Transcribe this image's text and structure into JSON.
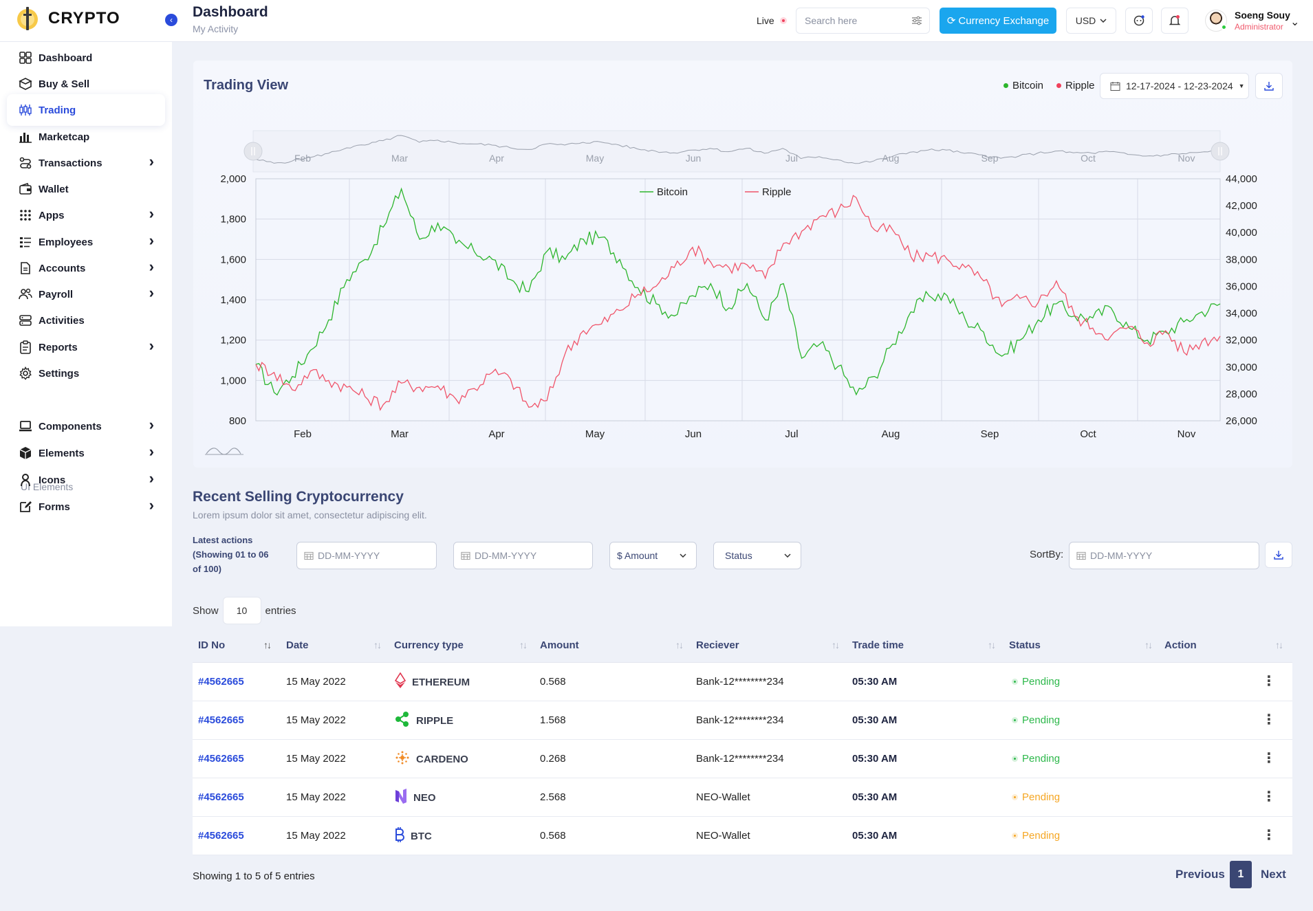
{
  "brand": {
    "name": "CRYPTO"
  },
  "header": {
    "title": "Dashboard",
    "subtitle": "My Activity",
    "live_label": "Live",
    "search_placeholder": "Search here",
    "exchange_label": "Currency Exchange",
    "currency": "USD",
    "user_name": "Soeng Souy",
    "user_role": "Administrator"
  },
  "sidebar": {
    "items": [
      {
        "label": "Dashboard",
        "icon": "grid-icon",
        "chevron": false
      },
      {
        "label": "Buy & Sell",
        "icon": "box-icon",
        "chevron": false
      },
      {
        "label": "Trading",
        "icon": "candlestick-icon",
        "chevron": false,
        "active": true
      },
      {
        "label": "Marketcap",
        "icon": "bar-chart-icon",
        "chevron": false
      },
      {
        "label": "Transactions",
        "icon": "transfer-icon",
        "chevron": true
      },
      {
        "label": "Wallet",
        "icon": "wallet-icon",
        "chevron": false
      },
      {
        "label": "Apps",
        "icon": "apps-icon",
        "chevron": true
      },
      {
        "label": "Employees",
        "icon": "list-icon",
        "chevron": true
      },
      {
        "label": "Accounts",
        "icon": "document-icon",
        "chevron": true
      },
      {
        "label": "Payroll",
        "icon": "users-icon",
        "chevron": true
      },
      {
        "label": "Activities",
        "icon": "server-icon",
        "chevron": false
      },
      {
        "label": "Reports",
        "icon": "clipboard-icon",
        "chevron": true
      },
      {
        "label": "Settings",
        "icon": "gear-icon",
        "chevron": false
      }
    ],
    "section_label": "UI Elements",
    "ui_items": [
      {
        "label": "Components",
        "icon": "laptop-icon",
        "chevron": true
      },
      {
        "label": "Elements",
        "icon": "cube-icon",
        "chevron": true
      },
      {
        "label": "Icons",
        "icon": "person-icon",
        "chevron": true
      },
      {
        "label": "Forms",
        "icon": "edit-icon",
        "chevron": true
      }
    ]
  },
  "trading": {
    "title": "Trading View",
    "legend": [
      "Bitcoin",
      "Ripple"
    ],
    "date_range": "12-17-2024 - 12-23-2024"
  },
  "chart_data": {
    "type": "line",
    "x_labels": [
      "Feb",
      "Mar",
      "Apr",
      "May",
      "Jun",
      "Jul",
      "Aug",
      "Sep",
      "Oct",
      "Nov"
    ],
    "y_left_ticks": [
      "2,000",
      "1,800",
      "1,600",
      "1,400",
      "1,200",
      "1,000",
      "800"
    ],
    "y_right_ticks": [
      "44,000",
      "42,000",
      "40,000",
      "38,000",
      "36,000",
      "34,000",
      "32,000",
      "30,000",
      "28,000",
      "26,000"
    ],
    "ylim_left": [
      800,
      2000
    ],
    "ylim_right": [
      26000,
      44000
    ],
    "grid": true,
    "legend_position": "top-center",
    "colors": {
      "Bitcoin": "#2cb52c",
      "Ripple": "#f0546a"
    },
    "series": [
      {
        "name": "Bitcoin",
        "axis": "left",
        "values": [
          1080,
          940,
          1020,
          1150,
          1300,
          1500,
          1600,
          1760,
          1950,
          1700,
          1780,
          1680,
          1640,
          1600,
          1500,
          1440,
          1640,
          1600,
          1700,
          1710,
          1600,
          1460,
          1380,
          1320,
          1420,
          1480,
          1360,
          1480,
          1300,
          1480,
          1110,
          1180,
          1070,
          930,
          1020,
          1180,
          1340,
          1420,
          1420,
          1300,
          1240,
          1120,
          1200,
          1300,
          1380,
          1320,
          1310,
          1360,
          1260,
          1200,
          1240,
          1290,
          1340,
          1380
        ]
      },
      {
        "name": "Ripple",
        "axis": "right",
        "values": [
          30200,
          29600,
          28300,
          29700,
          29000,
          28500,
          27800,
          27200,
          28800,
          28500,
          28600,
          27600,
          28400,
          29600,
          29100,
          27000,
          27500,
          31000,
          32700,
          33200,
          34200,
          35400,
          36000,
          37400,
          38900,
          37800,
          37400,
          37600,
          36600,
          39200,
          40100,
          41200,
          41600,
          42600,
          40200,
          40200,
          38200,
          38300,
          38000,
          37400,
          36400,
          34500,
          35100,
          34800,
          36400,
          33800,
          32900,
          32300,
          33000,
          31800,
          32700,
          31100,
          31900,
          32300
        ]
      }
    ],
    "navigator_labels": [
      "Feb",
      "Mar",
      "Apr",
      "May",
      "Jun",
      "Jul",
      "Aug",
      "Sep",
      "Oct",
      "Nov"
    ]
  },
  "recent": {
    "title": "Recent Selling Cryptocurrency",
    "subtitle": "Lorem ipsum dolor sit amet, consectetur adipiscing elit.",
    "latest_line1": "Latest actions",
    "latest_line2": "(Showing 01 to 06",
    "latest_line3": "of 100)",
    "date_placeholder": "DD-MM-YYYY",
    "amount_label": "$ Amount",
    "status_label": "Status",
    "sortby_label": "SortBy:",
    "show_label": "Show",
    "show_value": "10",
    "entries_label": "entries",
    "columns": [
      "ID No",
      "Date",
      "Currency type",
      "Amount",
      "Reciever",
      "Trade time",
      "Status",
      "Action"
    ],
    "rows": [
      {
        "id": "#4562665",
        "date": "15 May 2022",
        "currency": "ETHEREUM",
        "icon": "ethereum-icon",
        "amount": "0.568",
        "receiver": "Bank-12********234",
        "time": "05:30 AM",
        "status": "Pending",
        "status_color": "#2db84b"
      },
      {
        "id": "#4562665",
        "date": "15 May 2022",
        "currency": "RIPPLE",
        "icon": "ripple-icon",
        "amount": "1.568",
        "receiver": "Bank-12********234",
        "time": "05:30 AM",
        "status": "Pending",
        "status_color": "#2db84b"
      },
      {
        "id": "#4562665",
        "date": "15 May 2022",
        "currency": "CARDENO",
        "icon": "cardano-icon",
        "amount": "0.268",
        "receiver": "Bank-12********234",
        "time": "05:30 AM",
        "status": "Pending",
        "status_color": "#2db84b"
      },
      {
        "id": "#4562665",
        "date": "15 May 2022",
        "currency": "NEO",
        "icon": "neo-icon",
        "amount": "2.568",
        "receiver": "NEO-Wallet",
        "time": "05:30 AM",
        "status": "Pending",
        "status_color": "#f5a623"
      },
      {
        "id": "#4562665",
        "date": "15 May 2022",
        "currency": "BTC",
        "icon": "btc-icon",
        "amount": "0.568",
        "receiver": "NEO-Wallet",
        "time": "05:30 AM",
        "status": "Pending",
        "status_color": "#f5a623"
      }
    ],
    "footer": "Showing 1 to 5 of 5 entries",
    "prev_label": "Previous",
    "page": "1",
    "next_label": "Next"
  }
}
